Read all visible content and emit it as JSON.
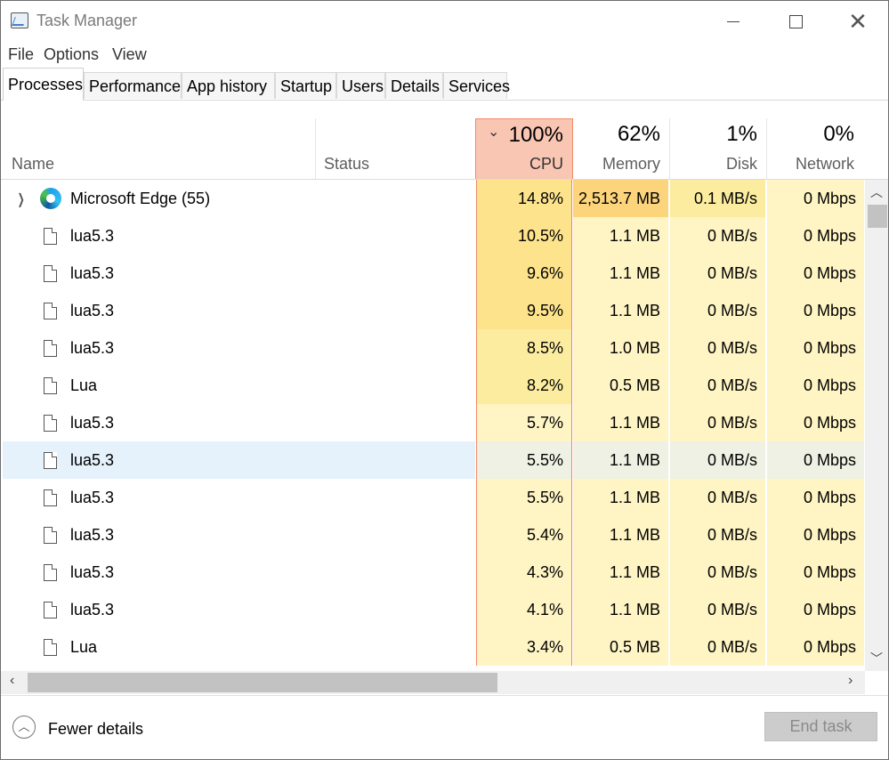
{
  "window": {
    "title": "Task Manager"
  },
  "menu": [
    "File",
    "Options",
    "View"
  ],
  "tabs": [
    "Processes",
    "Performance",
    "App history",
    "Startup",
    "Users",
    "Details",
    "Services"
  ],
  "columns": {
    "name": "Name",
    "status": "Status",
    "cpu": {
      "pct": "100%",
      "label": "CPU"
    },
    "memory": {
      "pct": "62%",
      "label": "Memory"
    },
    "disk": {
      "pct": "1%",
      "label": "Disk"
    },
    "network": {
      "pct": "0%",
      "label": "Network"
    }
  },
  "processes": [
    {
      "name": "Microsoft Edge (55)",
      "icon": "edge-icon",
      "expandable": true,
      "cpu": "14.8%",
      "memory": "2,513.7 MB",
      "disk": "0.1 MB/s",
      "network": "0 Mbps"
    },
    {
      "name": "lua5.3",
      "icon": "file-icon",
      "cpu": "10.5%",
      "memory": "1.1 MB",
      "disk": "0 MB/s",
      "network": "0 Mbps"
    },
    {
      "name": "lua5.3",
      "icon": "file-icon",
      "cpu": "9.6%",
      "memory": "1.1 MB",
      "disk": "0 MB/s",
      "network": "0 Mbps"
    },
    {
      "name": "lua5.3",
      "icon": "file-icon",
      "cpu": "9.5%",
      "memory": "1.1 MB",
      "disk": "0 MB/s",
      "network": "0 Mbps"
    },
    {
      "name": "lua5.3",
      "icon": "file-icon",
      "cpu": "8.5%",
      "memory": "1.0 MB",
      "disk": "0 MB/s",
      "network": "0 Mbps"
    },
    {
      "name": "Lua",
      "icon": "file-icon",
      "cpu": "8.2%",
      "memory": "0.5 MB",
      "disk": "0 MB/s",
      "network": "0 Mbps"
    },
    {
      "name": "lua5.3",
      "icon": "file-icon",
      "cpu": "5.7%",
      "memory": "1.1 MB",
      "disk": "0 MB/s",
      "network": "0 Mbps"
    },
    {
      "name": "lua5.3",
      "icon": "file-icon",
      "selected": true,
      "cpu": "5.5%",
      "memory": "1.1 MB",
      "disk": "0 MB/s",
      "network": "0 Mbps"
    },
    {
      "name": "lua5.3",
      "icon": "file-icon",
      "cpu": "5.5%",
      "memory": "1.1 MB",
      "disk": "0 MB/s",
      "network": "0 Mbps"
    },
    {
      "name": "lua5.3",
      "icon": "file-icon",
      "cpu": "5.4%",
      "memory": "1.1 MB",
      "disk": "0 MB/s",
      "network": "0 Mbps"
    },
    {
      "name": "lua5.3",
      "icon": "file-icon",
      "cpu": "4.3%",
      "memory": "1.1 MB",
      "disk": "0 MB/s",
      "network": "0 Mbps"
    },
    {
      "name": "lua5.3",
      "icon": "file-icon",
      "cpu": "4.1%",
      "memory": "1.1 MB",
      "disk": "0 MB/s",
      "network": "0 Mbps"
    },
    {
      "name": "Lua",
      "icon": "file-icon",
      "cpu": "3.4%",
      "memory": "0.5 MB",
      "disk": "0 MB/s",
      "network": "0 Mbps"
    }
  ],
  "footer": {
    "fewer_details": "Fewer details",
    "end_task": "End task"
  },
  "colors": {
    "heat_high": "#fde38b",
    "heat_mid": "#fcec9f",
    "heat_low": "#fff4c4",
    "heat_mem_high": "#fbd47b",
    "cpu_header": "#f9c6b3",
    "cpu_border": "#f08a68",
    "selection": "#e5f1fb"
  }
}
